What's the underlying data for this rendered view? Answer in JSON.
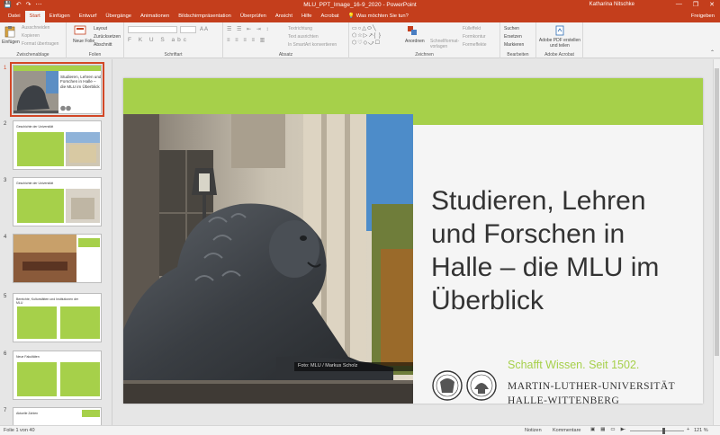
{
  "window": {
    "title": "MLU_PPT_Image_16-9_2020 - PowerPoint",
    "user": "Katharina Nitschke",
    "minimize": "—",
    "restore": "❐",
    "close": "✕",
    "qat_save": "💾",
    "qat_undo": "↶",
    "qat_redo": "↷",
    "qat_more": "⋯"
  },
  "ribbon_tabs": [
    "Datei",
    "Start",
    "Einfügen",
    "Entwurf",
    "Übergänge",
    "Animationen",
    "Bildschirmpräsentation",
    "Überprüfen",
    "Ansicht",
    "Hilfe",
    "Acrobat"
  ],
  "tell_me": "Was möchten Sie tun?",
  "share": "Freigeben",
  "ribbon": {
    "clipboard": {
      "label": "Zwischenablage",
      "paste": "Einfügen",
      "cut": "Ausschneiden",
      "copy": "Kopieren",
      "format": "Format übertragen"
    },
    "slides": {
      "label": "Folien",
      "new_slide": "Neue Folie",
      "layout": "Layout",
      "reset": "Zurücksetzen",
      "section": "Abschnitt"
    },
    "font": {
      "label": "Schriftart"
    },
    "paragraph": {
      "label": "Absatz",
      "text_direction": "Textrichtung",
      "align_text": "Text ausrichten",
      "smartart": "In SmartArt konvertieren"
    },
    "drawing": {
      "label": "Zeichnen",
      "arrange": "Anordnen",
      "quick_styles": "Schnellformat-vorlagen",
      "fill": "Fülleffekt",
      "outline": "Formkontur",
      "effects": "Formeffekte"
    },
    "editing": {
      "label": "Bearbeiten",
      "find": "Suchen",
      "replace": "Ersetzen",
      "select": "Markieren"
    },
    "acrobat": {
      "label": "Adobe Acrobat",
      "create_pdf": "Adobe PDF erstellen und teilen"
    }
  },
  "thumbnails": [
    {
      "num": "1",
      "title": "Studieren, Lehren und Forschen in Halle – die MLU im Überblick"
    },
    {
      "num": "2",
      "title": "Geschichte der Universität"
    },
    {
      "num": "3",
      "title": "Geschichte der Universität"
    },
    {
      "num": "4",
      "title": ""
    },
    {
      "num": "5",
      "title": "Bereichte, Kulturstätten und Institutionen der MLU"
    },
    {
      "num": "6",
      "title": "Neue Fakultäten"
    },
    {
      "num": "7",
      "title": "Aktuelle Zahlen"
    }
  ],
  "slide": {
    "title": "Studieren, Lehren und Forschen in Halle – die MLU im Überblick",
    "tagline": "Schafft Wissen. Seit 1502.",
    "university_line1": "MARTIN-LUTHER-UNIVERSITÄT",
    "university_line2": "HALLE-WITTENBERG",
    "photo_caption": "Foto: MLU / Markus Scholz"
  },
  "status": {
    "slide_info": "Folie 1 von 40",
    "notes": "Notizen",
    "comments": "Kommentare",
    "zoom": "121 %"
  },
  "colors": {
    "accent": "#c43e1c",
    "slide_green": "#a6d04a"
  }
}
